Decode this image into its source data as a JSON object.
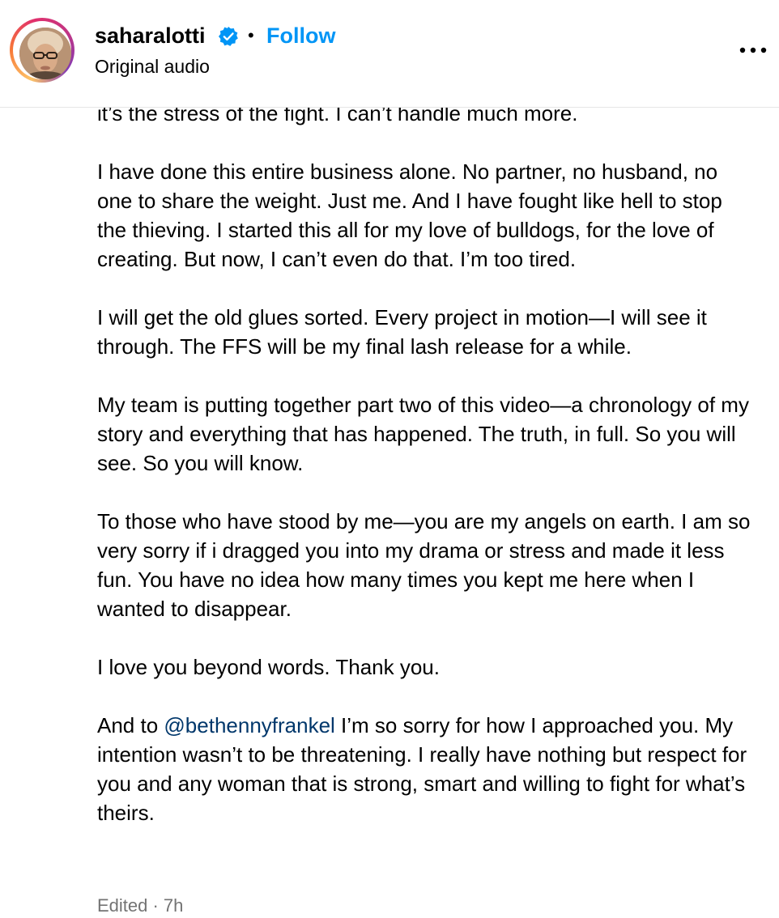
{
  "header": {
    "username": "saharalotti",
    "separator": "•",
    "follow_label": "Follow",
    "subtitle": "Original audio",
    "verified_icon": "verified-badge-icon",
    "more_icon": "more-options-icon"
  },
  "caption": {
    "p0": "it’s the stress of the fight. I can’t handle much more.",
    "p1": "I have done this entire business alone. No partner, no husband, no one to share the weight. Just me. And I have fought like hell to stop the thieving. I started this all for my love of bulldogs, for the love of creating. But now, I can’t even do that. I’m too tired.",
    "p2": "I will get the old glues sorted. Every project in motion—I will see it through. The FFS will be my final lash release for a while.",
    "p3": "My team is putting together part two of this video—a chronology of my story and everything that has happened. The truth, in full. So you will see. So you will know.",
    "p4": "To those who have stood by me—you are my angels on earth. I am so very sorry if i dragged you into my drama or stress and made it less fun. You have no idea how many times you kept me here when I wanted to disappear.",
    "p5": "I love you beyond words. Thank you.",
    "p6_before": "And to ",
    "p6_mention": "@bethennyfrankel",
    "p6_after": " I’m so sorry for how I approached you. My intention wasn’t to be threatening. I really have nothing but respect for you and any woman that is strong, smart and willing to fight for what’s theirs."
  },
  "meta": {
    "edited_time": "Edited · 7h"
  },
  "colors": {
    "follow": "#0095f6",
    "mention": "#00376b",
    "verified": "#0095f6",
    "meta": "#737373"
  }
}
